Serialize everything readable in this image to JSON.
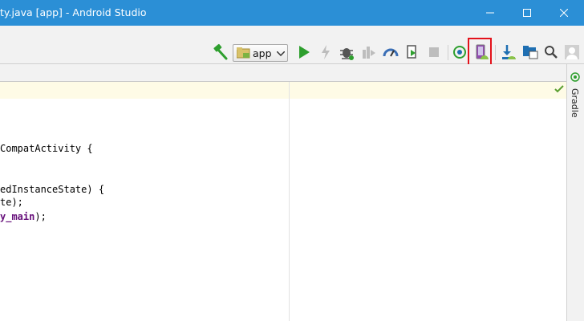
{
  "window": {
    "title": "ty.java [app] - Android Studio",
    "controls": [
      "minimize-icon",
      "maximize-icon",
      "close-icon"
    ]
  },
  "toolbar": {
    "run_config": "app",
    "icons": [
      "build-hammer-icon",
      "run-config-icon",
      "chevron-down-icon",
      "run-icon",
      "apply-changes-icon",
      "debug-icon",
      "attach-debugger-icon",
      "profile-icon",
      "run-tests-icon",
      "stop-icon",
      "sync-gradle-icon",
      "avd-manager-icon",
      "sdk-manager-icon",
      "project-structure-icon",
      "search-icon",
      "user-icon"
    ],
    "highlighted": "avd-manager-icon"
  },
  "editor": {
    "lines": [
      {
        "text": "CompatActivity {"
      },
      {
        "text": "edInstanceState) {"
      },
      {
        "text": "te);"
      },
      {
        "pre": "",
        "bold": "y_main",
        "post": ");"
      }
    ]
  },
  "right_sidebar": {
    "tab_label": "Gradle"
  },
  "colors": {
    "titlebar": "#2b8fd6",
    "toolbar": "#f2f2f2",
    "caret_row": "#fefbe6",
    "highlight_box": "#e3121b",
    "run_green": "#2e9f2e",
    "keyword_purple": "#660e7a"
  }
}
